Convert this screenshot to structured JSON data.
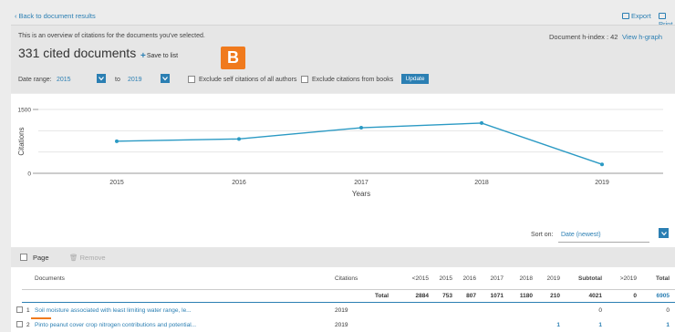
{
  "topbar": {
    "back_label": "Back to document results",
    "export_label": "Export",
    "print_label": "Print"
  },
  "header": {
    "overview_text": "This is an overview of citations for the documents you've selected.",
    "cited_docs_title": "331 cited documents",
    "save_to_list_label": "Save to list",
    "hindex_label": "Document h-index : 42",
    "view_hgraph_label": "View h-graph",
    "badge_letter": "B"
  },
  "date_range": {
    "label": "Date range:",
    "from_value": "2015",
    "to_label": "to",
    "to_value": "2019",
    "exclude_self_label": "Exclude self citations of all authors",
    "exclude_books_label": "Exclude citations from books",
    "update_label": "Update"
  },
  "chart_data": {
    "type": "line",
    "x": [
      "2015",
      "2016",
      "2017",
      "2018",
      "2019"
    ],
    "series": [
      {
        "values": [
          753,
          807,
          1071,
          1180,
          210
        ]
      }
    ],
    "xlabel": "Years",
    "ylabel": "Citations",
    "yticks": [
      0,
      1500
    ],
    "ylim": [
      0,
      1500
    ],
    "grid": true,
    "color": "#2b9ac4"
  },
  "sort": {
    "label": "Sort on:",
    "value": "Date (newest)"
  },
  "table": {
    "page_label": "Page",
    "remove_label": "Remove",
    "headers": {
      "documents": "Documents",
      "citations": "Citations",
      "lt2015": "<2015",
      "y2015": "2015",
      "y2016": "2016",
      "y2017": "2017",
      "y2018": "2018",
      "y2019": "2019",
      "subtotal": "Subtotal",
      "gt2019": ">2019",
      "total": "Total"
    },
    "total_row": {
      "label": "Total",
      "lt2015": "2884",
      "y2015": "753",
      "y2016": "807",
      "y2017": "1071",
      "y2018": "1180",
      "y2019": "210",
      "subtotal": "4021",
      "gt2019": "0",
      "total": "6905"
    },
    "rows": [
      {
        "num": "1",
        "title": "Soil moisture associated with least limiting water range, le...",
        "citations": "2019",
        "y2019": "",
        "subtotal": "0",
        "total": "0"
      },
      {
        "num": "2",
        "title": "Pinto peanut cover crop nitrogen contributions and potential...",
        "citations": "2019",
        "y2019": "1",
        "subtotal": "1",
        "total": "1"
      }
    ]
  }
}
